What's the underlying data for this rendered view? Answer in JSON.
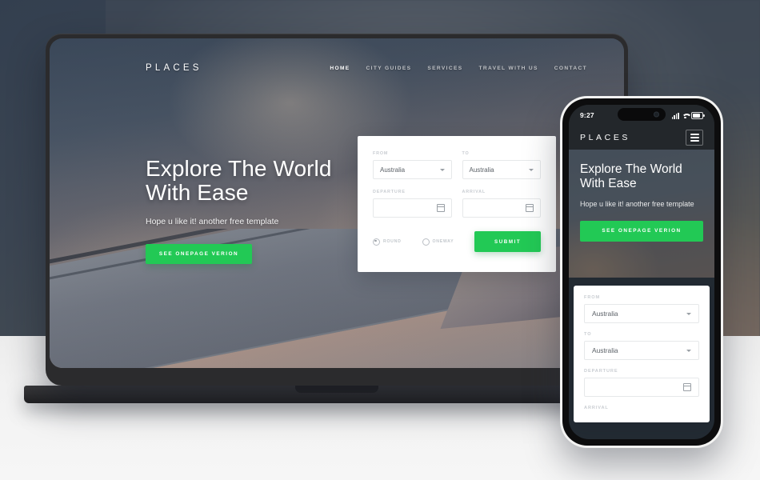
{
  "scene": {
    "description": "Responsive travel website mockup shown on a laptop and a smartphone",
    "background_color": "#3a4450",
    "floor_color": "#f2f2f2"
  },
  "brand": {
    "name": "PLACES",
    "accent_color": "#22c955"
  },
  "desktop": {
    "nav": {
      "logo": "PLACES",
      "items": [
        {
          "label": "HOME",
          "active": true
        },
        {
          "label": "CITY GUIDES",
          "active": false
        },
        {
          "label": "SERVICES",
          "active": false
        },
        {
          "label": "TRAVEL WITH US",
          "active": false
        },
        {
          "label": "CONTACT",
          "active": false
        }
      ]
    },
    "hero": {
      "title_line1": "Explore The World",
      "title_line2": "With Ease",
      "subtitle": "Hope u like it! another free template",
      "cta_label": "SEE ONEPAGE VERION"
    },
    "booking_form": {
      "from_label": "FROM",
      "from_value": "Australia",
      "to_label": "TO",
      "to_value": "Australia",
      "departure_label": "DEPARTURE",
      "departure_value": "",
      "arrival_label": "ARRIVAL",
      "arrival_value": "",
      "trip_options": [
        {
          "label": "ROUND",
          "selected": true
        },
        {
          "label": "ONEWAY",
          "selected": false
        }
      ],
      "submit_label": "SUBMIT"
    }
  },
  "mobile": {
    "status_bar": {
      "time": "9:27",
      "signal_icon": "cellular-signal-icon",
      "wifi_icon": "wifi-icon",
      "battery_icon": "battery-icon"
    },
    "nav": {
      "logo": "PLACES",
      "menu_icon": "hamburger-menu-icon"
    },
    "hero": {
      "title_line1": "Explore The World",
      "title_line2": "With Ease",
      "subtitle": "Hope u like it! another free template",
      "cta_label": "SEE ONEPAGE VERION"
    },
    "booking_form": {
      "from_label": "FROM",
      "from_value": "Australia",
      "to_label": "TO",
      "to_value": "Australia",
      "departure_label": "DEPARTURE",
      "departure_value": "",
      "arrival_label": "ARRIVAL"
    }
  }
}
